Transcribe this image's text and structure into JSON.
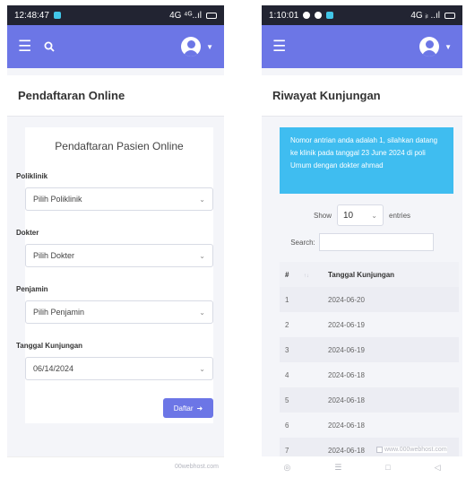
{
  "left": {
    "status": {
      "time": "12:48:47",
      "right": "4G ⁴ᴳ..ıl"
    },
    "page_title": "Pendaftaran Online",
    "form": {
      "title": "Pendaftaran Pasien Online",
      "fields": [
        {
          "label": "Poliklinik",
          "value": "Pilih Poliklinik"
        },
        {
          "label": "Dokter",
          "value": "Pilih Dokter"
        },
        {
          "label": "Penjamin",
          "value": "Pilih Penjamin"
        },
        {
          "label": "Tanggal Kunjungan",
          "value": "06/14/2024"
        }
      ],
      "submit_label": "Daftar"
    },
    "footer": "00webhost.com"
  },
  "right": {
    "status": {
      "time": "1:10:01",
      "right": "4G ᵢₗ ..ıl"
    },
    "page_title": "Riwayat Kunjungan",
    "alert": "Nomor antrian anda adalah 1, silahkan datang ke klinik pada tanggal 23 June 2024 di poli Umum dengan dokter ahmad",
    "table_controls": {
      "show_label": "Show",
      "entries_value": "10",
      "entries_label": "entries",
      "search_label": "Search:"
    },
    "table": {
      "headers": [
        "#",
        "Tanggal Kunjungan"
      ],
      "rows": [
        [
          "1",
          "2024-06-20"
        ],
        [
          "2",
          "2024-06-19"
        ],
        [
          "3",
          "2024-06-19"
        ],
        [
          "4",
          "2024-06-18"
        ],
        [
          "5",
          "2024-06-18"
        ],
        [
          "6",
          "2024-06-18"
        ],
        [
          "7",
          "2024-06-18"
        ]
      ]
    },
    "watermark": "www.000webhost.com"
  },
  "colors": {
    "navbar": "#6c76e6",
    "alert": "#3fbdf0",
    "statusbar": "#222432"
  },
  "icons": [
    "hamburger-icon",
    "search-icon",
    "avatar-icon",
    "chevron-down-icon",
    "arrow-right-icon",
    "sort-icon"
  ]
}
